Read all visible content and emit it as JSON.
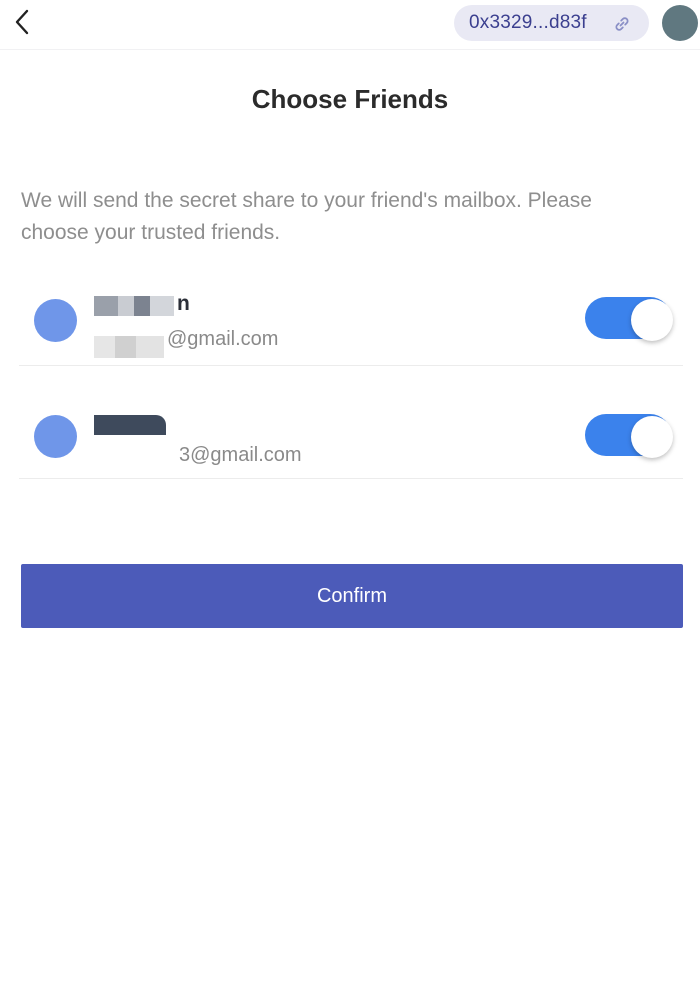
{
  "header": {
    "back_icon": "chevron-left-icon",
    "address": "0x3329...d83f",
    "link_icon": "link-icon",
    "avatar_color": "#607880"
  },
  "title": "Choose Friends",
  "description": "We will send the secret share to your friend's mailbox. Please choose your trusted friends.",
  "friends": [
    {
      "name_visible": "n",
      "email_visible": "@gmail.com",
      "selected": true
    },
    {
      "name_visible": "",
      "email_visible": "3@gmail.com",
      "selected": true
    }
  ],
  "confirm_label": "Confirm",
  "colors": {
    "accent": "#4c5bb9",
    "toggle_on": "#3b82ec",
    "friend_avatar": "#6f96e9",
    "address_pill_bg": "#e9e9f4"
  }
}
